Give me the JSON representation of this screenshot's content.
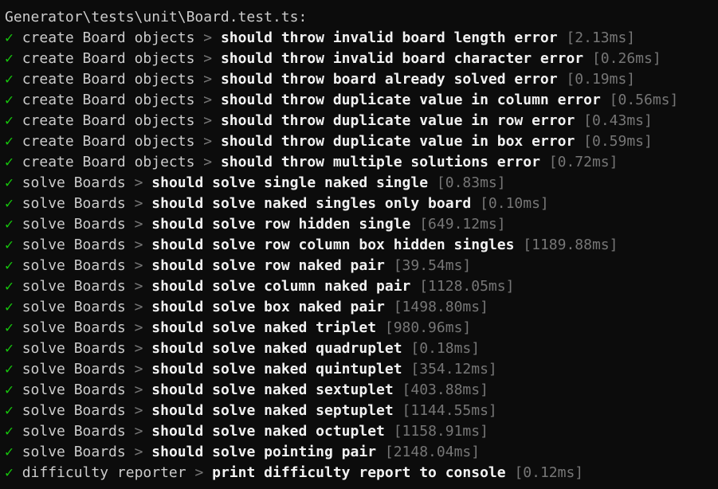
{
  "header": "Generator\\tests\\unit\\Board.test.ts:",
  "check_glyph": "✓",
  "separator": ">",
  "colors": {
    "background": "#0c0c0c",
    "pass": "#16c60c",
    "text": "#cccccc",
    "test_name": "#f2f2f2",
    "dim": "#767676"
  },
  "results": [
    {
      "suite": "create Board objects",
      "test": "should throw invalid board length error",
      "time": "[2.13ms]"
    },
    {
      "suite": "create Board objects",
      "test": "should throw invalid board character error",
      "time": "[0.26ms]"
    },
    {
      "suite": "create Board objects",
      "test": "should throw board already solved error",
      "time": "[0.19ms]"
    },
    {
      "suite": "create Board objects",
      "test": "should throw duplicate value in column error",
      "time": "[0.56ms]"
    },
    {
      "suite": "create Board objects",
      "test": "should throw duplicate value in row error",
      "time": "[0.43ms]"
    },
    {
      "suite": "create Board objects",
      "test": "should throw duplicate value in box error",
      "time": "[0.59ms]"
    },
    {
      "suite": "create Board objects",
      "test": "should throw multiple solutions error",
      "time": "[0.72ms]"
    },
    {
      "suite": "solve Boards",
      "test": "should solve single naked single",
      "time": "[0.83ms]"
    },
    {
      "suite": "solve Boards",
      "test": "should solve naked singles only board",
      "time": "[0.10ms]"
    },
    {
      "suite": "solve Boards",
      "test": "should solve row hidden single",
      "time": "[649.12ms]"
    },
    {
      "suite": "solve Boards",
      "test": "should solve row column box hidden singles",
      "time": "[1189.88ms]"
    },
    {
      "suite": "solve Boards",
      "test": "should solve row naked pair",
      "time": "[39.54ms]"
    },
    {
      "suite": "solve Boards",
      "test": "should solve column naked pair",
      "time": "[1128.05ms]"
    },
    {
      "suite": "solve Boards",
      "test": "should solve box naked pair",
      "time": "[1498.80ms]"
    },
    {
      "suite": "solve Boards",
      "test": "should solve naked triplet",
      "time": "[980.96ms]"
    },
    {
      "suite": "solve Boards",
      "test": "should solve naked quadruplet",
      "time": "[0.18ms]"
    },
    {
      "suite": "solve Boards",
      "test": "should solve naked quintuplet",
      "time": "[354.12ms]"
    },
    {
      "suite": "solve Boards",
      "test": "should solve naked sextuplet",
      "time": "[403.88ms]"
    },
    {
      "suite": "solve Boards",
      "test": "should solve naked septuplet",
      "time": "[1144.55ms]"
    },
    {
      "suite": "solve Boards",
      "test": "should solve naked octuplet",
      "time": "[1158.91ms]"
    },
    {
      "suite": "solve Boards",
      "test": "should solve pointing pair",
      "time": "[2148.04ms]"
    },
    {
      "suite": "difficulty reporter",
      "test": "print difficulty report to console",
      "time": "[0.12ms]"
    }
  ]
}
